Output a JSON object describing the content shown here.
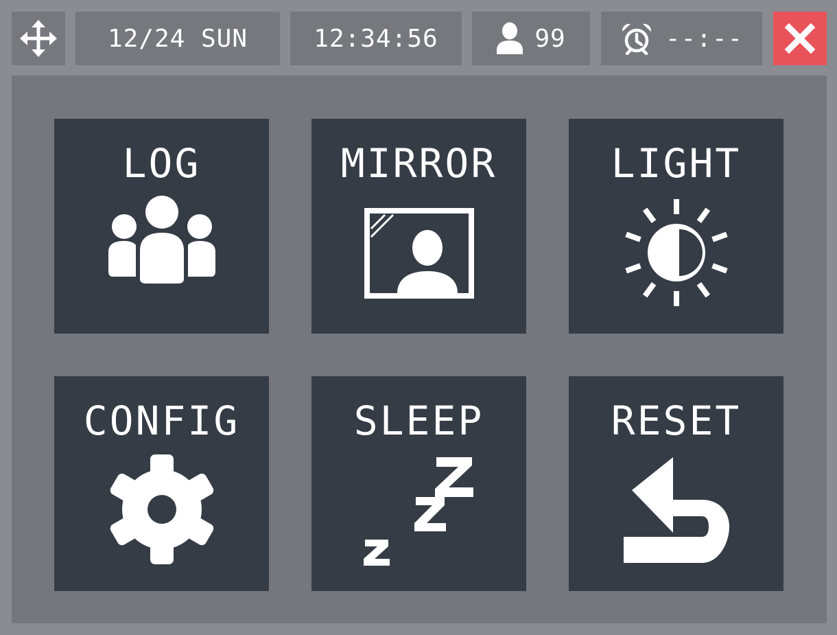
{
  "topbar": {
    "date": "12/24 SUN",
    "time": "12:34:56",
    "user_count": "99",
    "alarm_time": "--:--",
    "icons": {
      "move": "move-arrows-icon",
      "user": "user-icon",
      "alarm": "alarm-clock-icon",
      "close": "close-icon"
    },
    "close_color": "#e8535a"
  },
  "tiles": [
    {
      "label": "LOG",
      "icon": "people-group-icon"
    },
    {
      "label": "MIRROR",
      "icon": "portrait-frame-icon"
    },
    {
      "label": "LIGHT",
      "icon": "brightness-icon"
    },
    {
      "label": "CONFIG",
      "icon": "gear-icon"
    },
    {
      "label": "SLEEP",
      "icon": "zzz-icon"
    },
    {
      "label": "RESET",
      "icon": "undo-arrow-icon"
    }
  ],
  "colors": {
    "background": "#8a8c92",
    "panel": "#76777d",
    "tile": "#353c45",
    "text": "#ffffff"
  }
}
